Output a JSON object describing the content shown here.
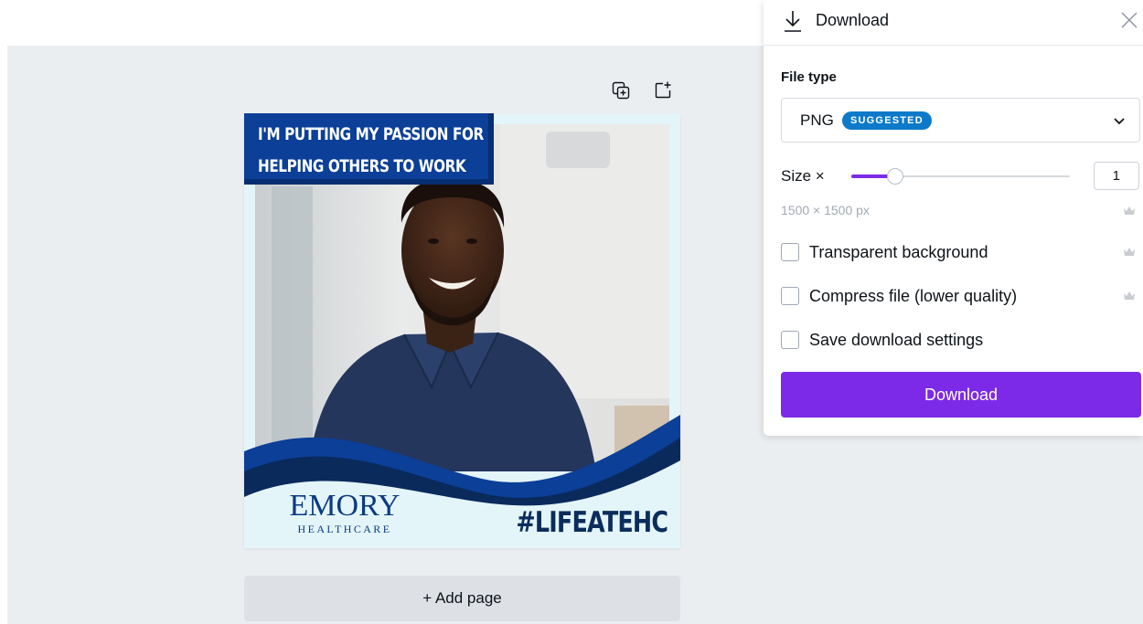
{
  "design": {
    "headline_line1": "I'M PUTTING MY PASSION FOR",
    "headline_line2": "HELPING OTHERS TO WORK",
    "logo_name": "EMORY",
    "logo_sub": "HEALTHCARE",
    "hashtag": "#LIFEATEHC",
    "photo_icon": "smiling-man-photo"
  },
  "page_tools": {
    "duplicate_icon": "duplicate-page-icon",
    "add_icon": "add-page-icon"
  },
  "add_page_label": "+ Add page",
  "download_panel": {
    "title": "Download",
    "header_icon": "download-icon",
    "close_icon": "close-icon",
    "file_type_label": "File type",
    "file_type_value": "PNG",
    "file_type_badge": "SUGGESTED",
    "size_label": "Size ×",
    "size_value": "1",
    "size_slider_fraction": 0.2,
    "dimensions": "1500 × 1500 px",
    "premium_icon": "crown-icon",
    "options": [
      {
        "label": "Transparent background",
        "checked": false,
        "premium": true
      },
      {
        "label": "Compress file (lower quality)",
        "checked": false,
        "premium": true
      },
      {
        "label": "Save download settings",
        "checked": false,
        "premium": false
      }
    ],
    "download_button": "Download"
  },
  "colors": {
    "accent": "#7d2ae8",
    "badge": "#0c7ac9",
    "brand_navy": "#0b3f98"
  }
}
